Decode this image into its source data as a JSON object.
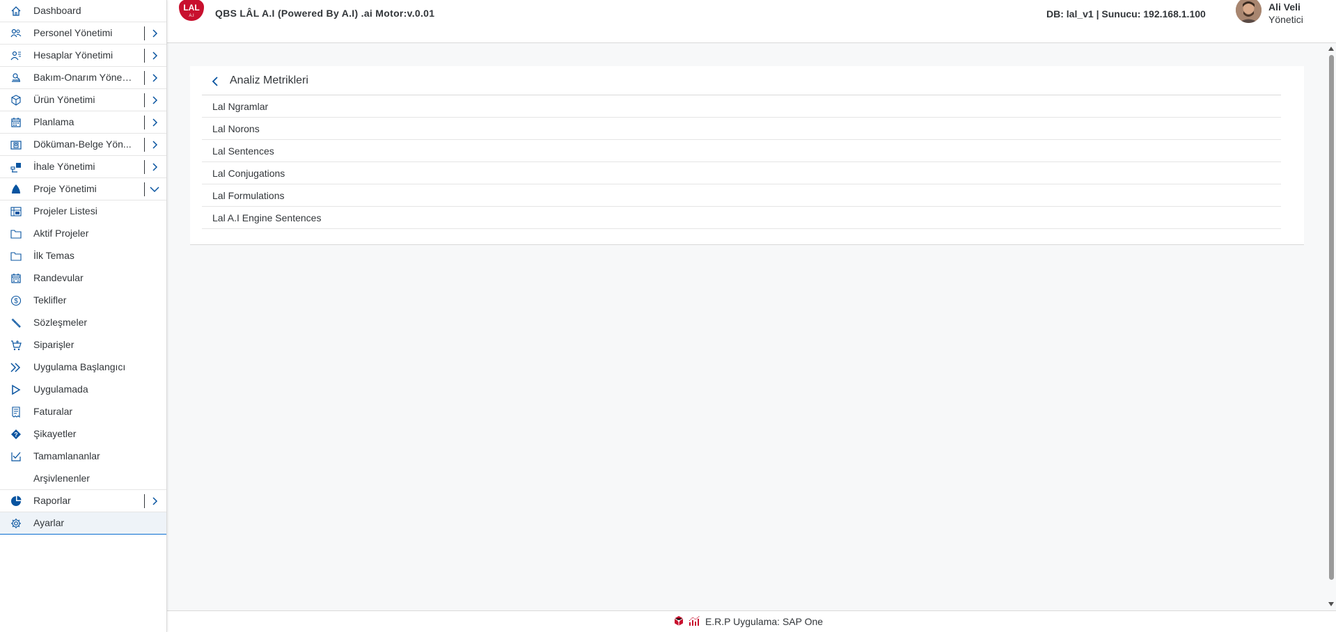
{
  "header": {
    "logo_text": "LAL",
    "logo_subtext": "A.I",
    "app_title": "QBS LÂL A.I (Powered By A.I) .ai Motor:v.0.01",
    "db_info": "DB: lal_v1 | Sunucu: 192.168.1.100",
    "user_name": "Ali Veli",
    "user_role": "Yönetici"
  },
  "sidebar": {
    "items": [
      {
        "label": "Dashboard",
        "icon": "home-icon"
      },
      {
        "label": "Personel Yönetimi",
        "icon": "people-icon"
      },
      {
        "label": "Hesaplar Yönetimi",
        "icon": "accounts-icon"
      },
      {
        "label": "Bakım-Onarım Yöneti...",
        "icon": "maintenance-icon"
      },
      {
        "label": "Ürün Yönetimi",
        "icon": "product-icon"
      },
      {
        "label": "Planlama",
        "icon": "calendar-icon"
      },
      {
        "label": "Döküman-Belge Yön...",
        "icon": "document-icon"
      },
      {
        "label": "İhale Yönetimi",
        "icon": "tender-icon"
      },
      {
        "label": "Proje Yönetimi",
        "icon": "project-icon"
      },
      {
        "label": "Projeler Listesi",
        "icon": "project-list-icon"
      },
      {
        "label": "Aktif Projeler",
        "icon": "folder-icon"
      },
      {
        "label": "İlk Temas",
        "icon": "folder-icon"
      },
      {
        "label": "Randevular",
        "icon": "appointment-icon"
      },
      {
        "label": "Teklifler",
        "icon": "dollar-icon"
      },
      {
        "label": "Sözleşmeler",
        "icon": "wrench-icon"
      },
      {
        "label": "Siparişler",
        "icon": "cart-icon"
      },
      {
        "label": "Uygulama Başlangıcı",
        "icon": "fast-forward-icon"
      },
      {
        "label": "Uygulamada",
        "icon": "play-icon"
      },
      {
        "label": "Faturalar",
        "icon": "invoice-icon"
      },
      {
        "label": "Şikayetler",
        "icon": "question-icon"
      },
      {
        "label": "Tamamlananlar",
        "icon": "checkbox-icon"
      },
      {
        "label": "Arşivlenenler",
        "icon": ""
      },
      {
        "label": "Raporlar",
        "icon": "pie-chart-icon"
      },
      {
        "label": "Ayarlar",
        "icon": "gear-icon"
      }
    ]
  },
  "main": {
    "title": "Analiz Metrikleri",
    "metrics": [
      "Lal Ngramlar",
      "Lal Norons",
      "Lal Sentences",
      "Lal Conjugations",
      "Lal Formulations",
      "Lal A.I Engine Sentences"
    ]
  },
  "footer": {
    "text": "E.R.P Uygulama: SAP One"
  },
  "colors": {
    "accent": "#0a6ed1",
    "icon": "#0854a0",
    "text": "#32363a",
    "logo_red": "#c8102e"
  }
}
